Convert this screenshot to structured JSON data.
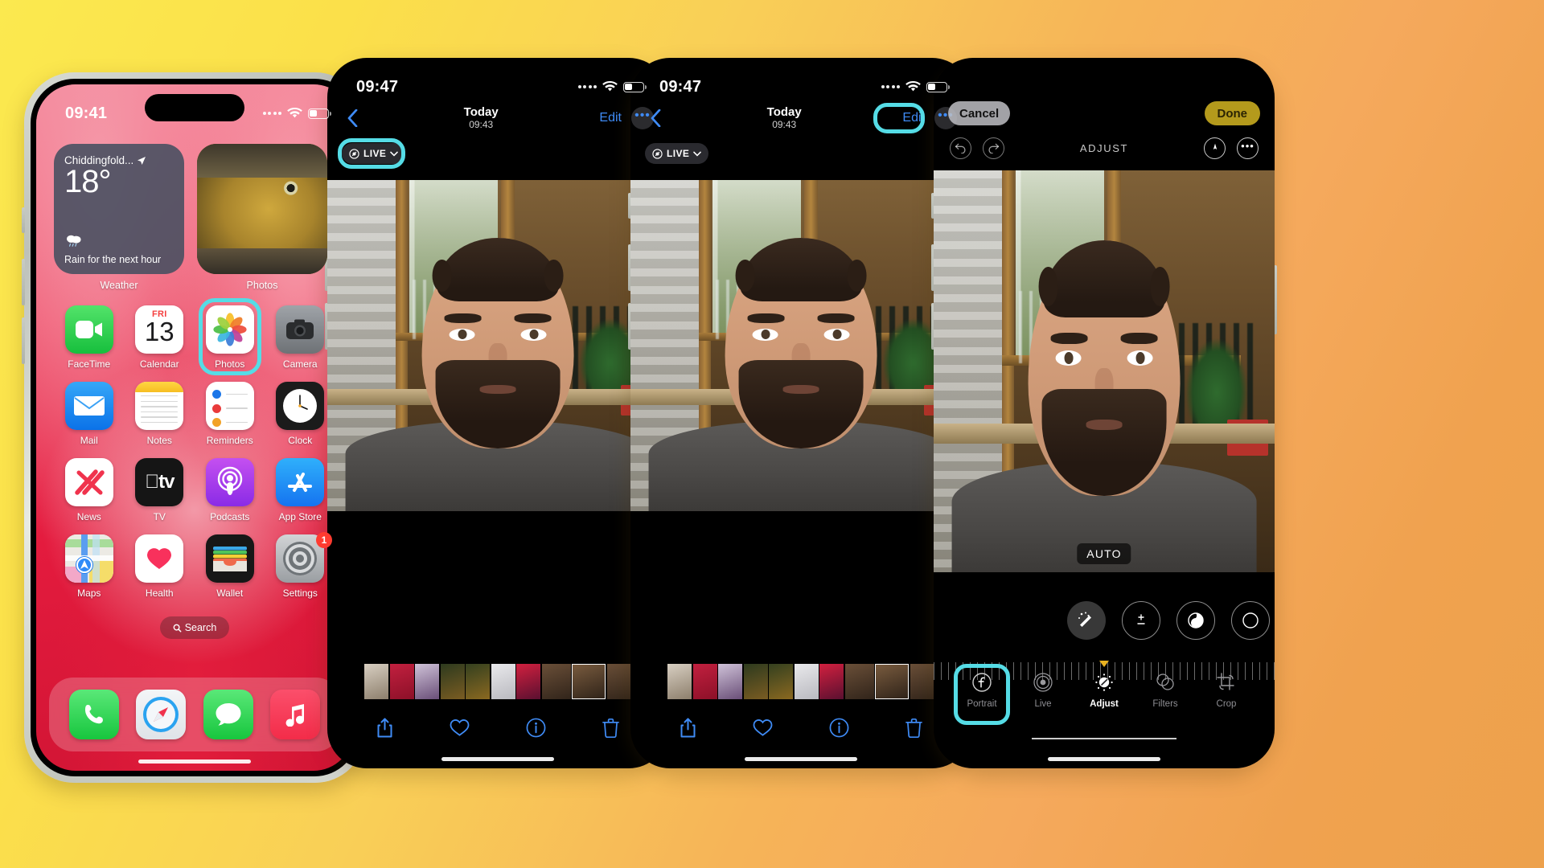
{
  "screens": [
    {
      "id": "home-screen",
      "status": {
        "time": "09:41",
        "wifi_icon": "wifi-icon",
        "battery_icon": "battery-icon",
        "signal_icon": "cellular-dots-icon"
      },
      "widgets": [
        {
          "name": "Weather",
          "location": "Chiddingfold...",
          "temperature": "18°",
          "condition": "Rain for the next hour",
          "label": "Weather",
          "icon": "rain-cloud-icon"
        },
        {
          "name": "Photos",
          "label": "Photos",
          "icon": "photo-thumbnail-fish"
        }
      ],
      "apps": [
        {
          "label": "FaceTime",
          "icon": "facetime-icon"
        },
        {
          "label": "Calendar",
          "icon": "calendar-icon",
          "day_of_week": "FRI",
          "day": "13"
        },
        {
          "label": "Photos",
          "icon": "photos-icon",
          "highlighted": true
        },
        {
          "label": "Camera",
          "icon": "camera-icon"
        },
        {
          "label": "Mail",
          "icon": "mail-icon"
        },
        {
          "label": "Notes",
          "icon": "notes-icon"
        },
        {
          "label": "Reminders",
          "icon": "reminders-icon"
        },
        {
          "label": "Clock",
          "icon": "clock-icon"
        },
        {
          "label": "News",
          "icon": "news-icon"
        },
        {
          "label": "TV",
          "icon": "tv-icon"
        },
        {
          "label": "Podcasts",
          "icon": "podcasts-icon"
        },
        {
          "label": "App Store",
          "icon": "app-store-icon"
        },
        {
          "label": "Maps",
          "icon": "maps-icon"
        },
        {
          "label": "Health",
          "icon": "health-icon"
        },
        {
          "label": "Wallet",
          "icon": "wallet-icon"
        },
        {
          "label": "Settings",
          "icon": "settings-icon",
          "badge": "1"
        }
      ],
      "search": {
        "label": "Search",
        "icon": "search-icon"
      },
      "dock": [
        {
          "label": "Phone",
          "icon": "phone-icon"
        },
        {
          "label": "Safari",
          "icon": "safari-icon"
        },
        {
          "label": "Messages",
          "icon": "messages-icon"
        },
        {
          "label": "Music",
          "icon": "music-icon"
        }
      ]
    },
    {
      "id": "photo-viewer",
      "status": {
        "time": "09:47"
      },
      "nav": {
        "back_icon": "chevron-left-icon",
        "title": "Today",
        "subtitle": "09:43",
        "edit_label": "Edit",
        "more_icon": "ellipsis-circle-icon"
      },
      "live_chip": {
        "label": "LIVE",
        "icon": "live-photo-icon",
        "chevron": "chevron-down-icon",
        "highlighted": true
      },
      "tools": [
        {
          "name": "share",
          "icon": "share-icon"
        },
        {
          "name": "favorite",
          "icon": "heart-icon"
        },
        {
          "name": "info",
          "icon": "info-circle-icon"
        },
        {
          "name": "delete",
          "icon": "trash-icon"
        }
      ],
      "edit_highlighted": false
    },
    {
      "id": "photo-viewer-edit-highlight",
      "status": {
        "time": "09:47"
      },
      "nav": {
        "back_icon": "chevron-left-icon",
        "title": "Today",
        "subtitle": "09:43",
        "edit_label": "Edit",
        "more_icon": "ellipsis-circle-icon"
      },
      "live_chip": {
        "label": "LIVE",
        "icon": "live-photo-icon",
        "chevron": "chevron-down-icon",
        "highlighted": false
      },
      "tools": [
        {
          "name": "share",
          "icon": "share-icon"
        },
        {
          "name": "favorite",
          "icon": "heart-icon"
        },
        {
          "name": "info",
          "icon": "info-circle-icon"
        },
        {
          "name": "delete",
          "icon": "trash-icon"
        }
      ],
      "edit_highlighted": true
    },
    {
      "id": "photo-editor",
      "top": {
        "cancel_label": "Cancel",
        "done_label": "Done"
      },
      "subbar": {
        "undo_icon": "undo-icon",
        "redo_icon": "redo-icon",
        "mode_label": "ADJUST",
        "markup_icon": "markup-pen-icon",
        "more_icon": "ellipsis-circle-icon"
      },
      "auto_badge": "AUTO",
      "dials": [
        {
          "name": "auto-enhance",
          "icon": "magic-wand-icon",
          "active": true
        },
        {
          "name": "exposure",
          "icon": "exposure-icon",
          "active": false
        },
        {
          "name": "brilliance",
          "icon": "brilliance-icon",
          "active": false
        },
        {
          "name": "highlights",
          "icon": "highlights-icon",
          "active": false
        }
      ],
      "tabs": [
        {
          "label": "Portrait",
          "icon": "portrait-f-icon",
          "active": false,
          "highlighted": true
        },
        {
          "label": "Live",
          "icon": "live-photo-icon",
          "active": false,
          "highlighted": false
        },
        {
          "label": "Adjust",
          "icon": "adjust-dial-icon",
          "active": true,
          "highlighted": false
        },
        {
          "label": "Filters",
          "icon": "filters-circles-icon",
          "active": false,
          "highlighted": false
        },
        {
          "label": "Crop",
          "icon": "crop-rotate-icon",
          "active": false,
          "highlighted": false
        }
      ]
    }
  ],
  "colors": {
    "highlight": "#55dce6",
    "ios_blue": "#3f8bf5",
    "done_gold": "#b49a1c",
    "badge_red": "#ff3b30",
    "background_start": "#fbe94f",
    "background_end": "#eda14c"
  }
}
